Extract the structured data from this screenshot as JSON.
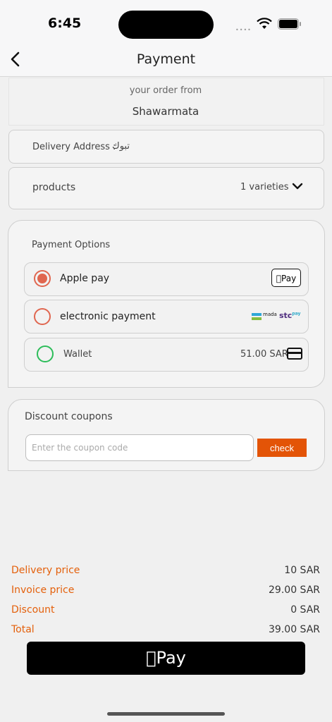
{
  "status_bar": {
    "time": "6:45"
  },
  "header": {
    "title": "Payment"
  },
  "order": {
    "from_label": "your order from",
    "shop_name": "Shawarmata"
  },
  "address": {
    "label": "Delivery Address :",
    "value": "تبوك"
  },
  "products": {
    "label": "products",
    "count": "1 varieties"
  },
  "payment_options": {
    "title": "Payment Options",
    "options": [
      {
        "label": "Apple pay",
        "badge": "Pay",
        "selected": true
      },
      {
        "label": "electronic payment",
        "badge_mada": "mada",
        "badge_stc": "stc",
        "badge_stc_sup": "pay",
        "selected": false
      },
      {
        "label": "Wallet",
        "amount": "51.00 SAR",
        "selected": false
      }
    ]
  },
  "coupon": {
    "title": "Discount coupons",
    "placeholder": "Enter the coupon code",
    "button": "check"
  },
  "summary": [
    {
      "label": "Delivery price",
      "value": "10 SAR"
    },
    {
      "label": "Invoice price",
      "value": "29.00 SAR"
    },
    {
      "label": "Discount",
      "value": "0 SAR"
    },
    {
      "label": "Total",
      "value": "39.00 SAR"
    }
  ],
  "pay_button": {
    "label": "Pay"
  },
  "colors": {
    "accent": "#e35407",
    "summary_label": "#e4600b",
    "wallet_radio": "#2dbd5a",
    "radio": "#e0664f"
  }
}
